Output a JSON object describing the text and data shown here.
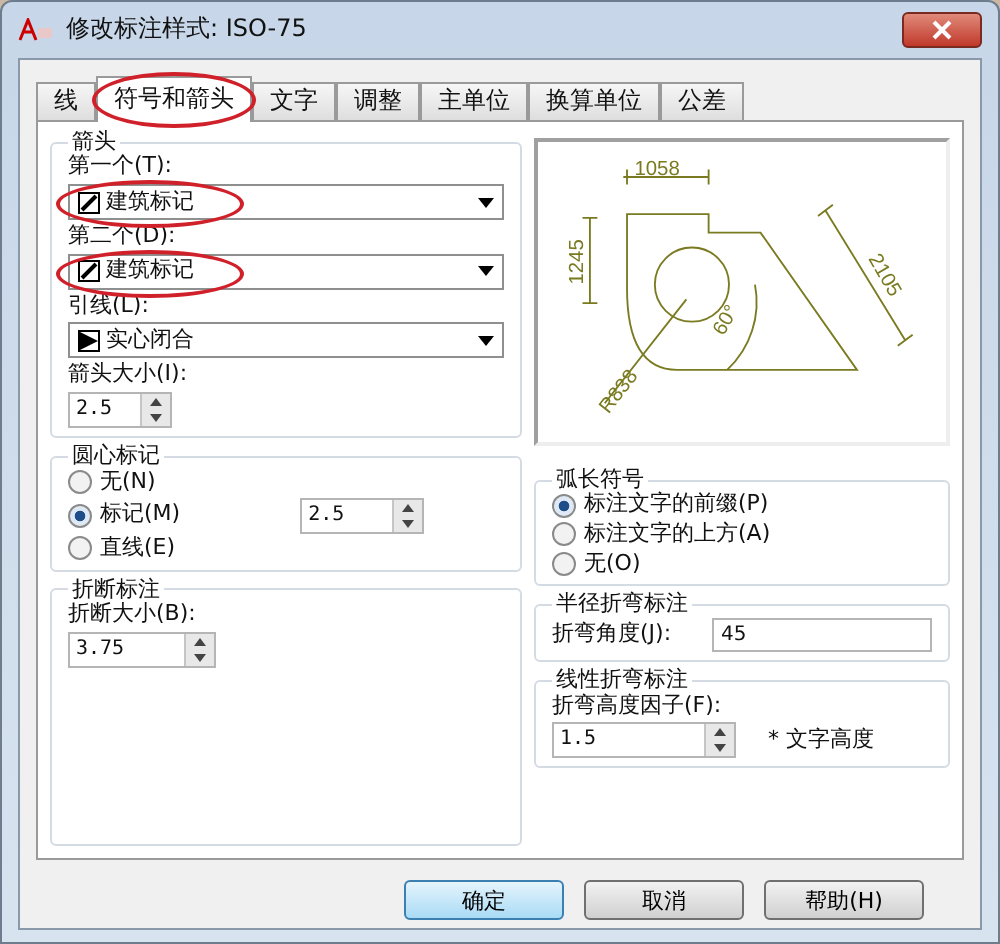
{
  "window": {
    "title": "修改标注样式: ISO-75"
  },
  "tabs": [
    {
      "label": "线",
      "selected": false,
      "highlighted": false
    },
    {
      "label": "符号和箭头",
      "selected": true,
      "highlighted": true
    },
    {
      "label": "文字",
      "selected": false,
      "highlighted": false
    },
    {
      "label": "调整",
      "selected": false,
      "highlighted": false
    },
    {
      "label": "主单位",
      "selected": false,
      "highlighted": false
    },
    {
      "label": "换算单位",
      "selected": false,
      "highlighted": false
    },
    {
      "label": "公差",
      "selected": false,
      "highlighted": false
    }
  ],
  "arrowheads": {
    "title": "箭头",
    "fields": [
      {
        "label": "第一个(T):",
        "value": "建筑标记",
        "kind": "dropdown",
        "highlighted": true
      },
      {
        "label": "第二个(D):",
        "value": "建筑标记",
        "kind": "dropdown",
        "highlighted": true
      },
      {
        "label": "引线(L):",
        "value": "实心闭合",
        "kind": "dropdown",
        "highlighted": false
      },
      {
        "label": "箭头大小(I):",
        "value": "2.5",
        "kind": "spinner",
        "highlighted": false
      }
    ]
  },
  "preview": {
    "labels": [
      "1058",
      "1245",
      "2105",
      "60°",
      "R838"
    ]
  },
  "center_marks": {
    "title": "圆心标记",
    "options": [
      {
        "label": "无(N)",
        "selected": false
      },
      {
        "label": "标记(M)",
        "selected": true
      },
      {
        "label": "直线(E)",
        "selected": false
      }
    ],
    "size": "2.5"
  },
  "dimension_break": {
    "title": "折断标注",
    "label": "折断大小(B):",
    "value": "3.75"
  },
  "arc_length": {
    "title": "弧长符号",
    "options": [
      {
        "label": "标注文字的前缀(P)",
        "selected": true
      },
      {
        "label": "标注文字的上方(A)",
        "selected": false
      },
      {
        "label": "无(O)",
        "selected": false
      }
    ]
  },
  "radius_jog": {
    "title": "半径折弯标注",
    "label": "折弯角度(J):",
    "value": "45"
  },
  "linear_jog": {
    "title": "线性折弯标注",
    "label": "折弯高度因子(F):",
    "value": "1.5",
    "suffix": "* 文字高度"
  },
  "buttons": [
    {
      "label": "确定",
      "default": true
    },
    {
      "label": "取消",
      "default": false
    },
    {
      "label": "帮助(H)",
      "default": false
    }
  ]
}
